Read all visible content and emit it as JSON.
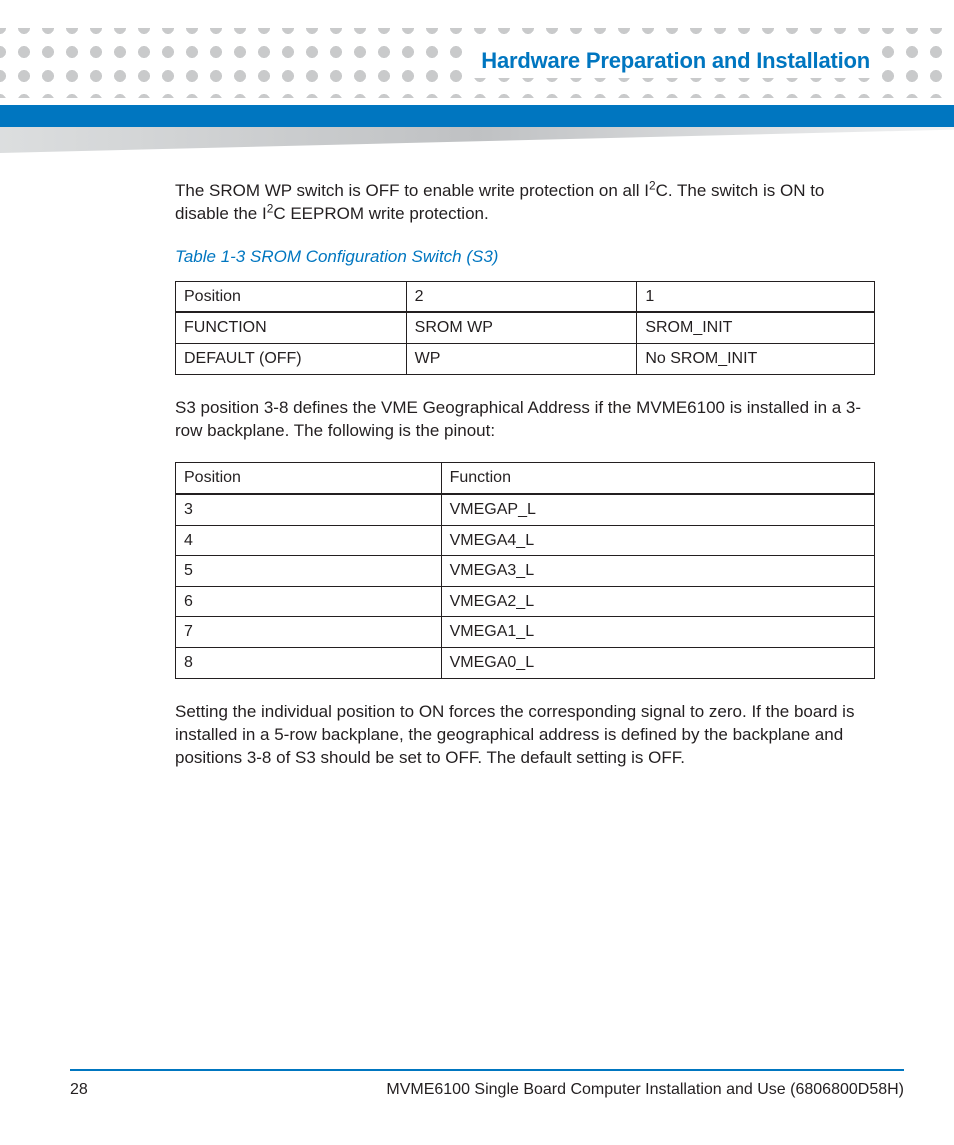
{
  "header": {
    "section_title": "Hardware Preparation and Installation"
  },
  "body": {
    "p1a": "The SROM WP switch is OFF to enable write protection on all I",
    "p1b": "C. The switch is ON to disable the I",
    "p1c": "C EEPROM write protection.",
    "sup": "2",
    "table1_caption": "Table 1-3 SROM Configuration Switch (S3)",
    "table1": {
      "h0": "Position",
      "h1": "2",
      "h2": "1",
      "r1c0": "FUNCTION",
      "r1c1": "SROM WP",
      "r1c2": "SROM_INIT",
      "r2c0": "DEFAULT (OFF)",
      "r2c1": "WP",
      "r2c2": "No SROM_INIT"
    },
    "p2": "S3 position 3-8 defines the VME Geographical Address if the MVME6100 is installed in a 3-row backplane. The following is the pinout:",
    "table2": {
      "h0": "Position",
      "h1": "Function",
      "rows": [
        {
          "c0": "3",
          "c1": "VMEGAP_L"
        },
        {
          "c0": "4",
          "c1": "VMEGA4_L"
        },
        {
          "c0": "5",
          "c1": "VMEGA3_L"
        },
        {
          "c0": "6",
          "c1": "VMEGA2_L"
        },
        {
          "c0": "7",
          "c1": "VMEGA1_L"
        },
        {
          "c0": "8",
          "c1": "VMEGA0_L"
        }
      ]
    },
    "p3": "Setting the individual position to ON forces the corresponding signal to zero. If the board is installed in a 5-row backplane, the geographical address is defined by the backplane and positions 3-8 of S3 should be set to OFF. The default setting is OFF."
  },
  "footer": {
    "page_number": "28",
    "doc_title": "MVME6100 Single Board Computer Installation and Use (6806800D58H)"
  }
}
